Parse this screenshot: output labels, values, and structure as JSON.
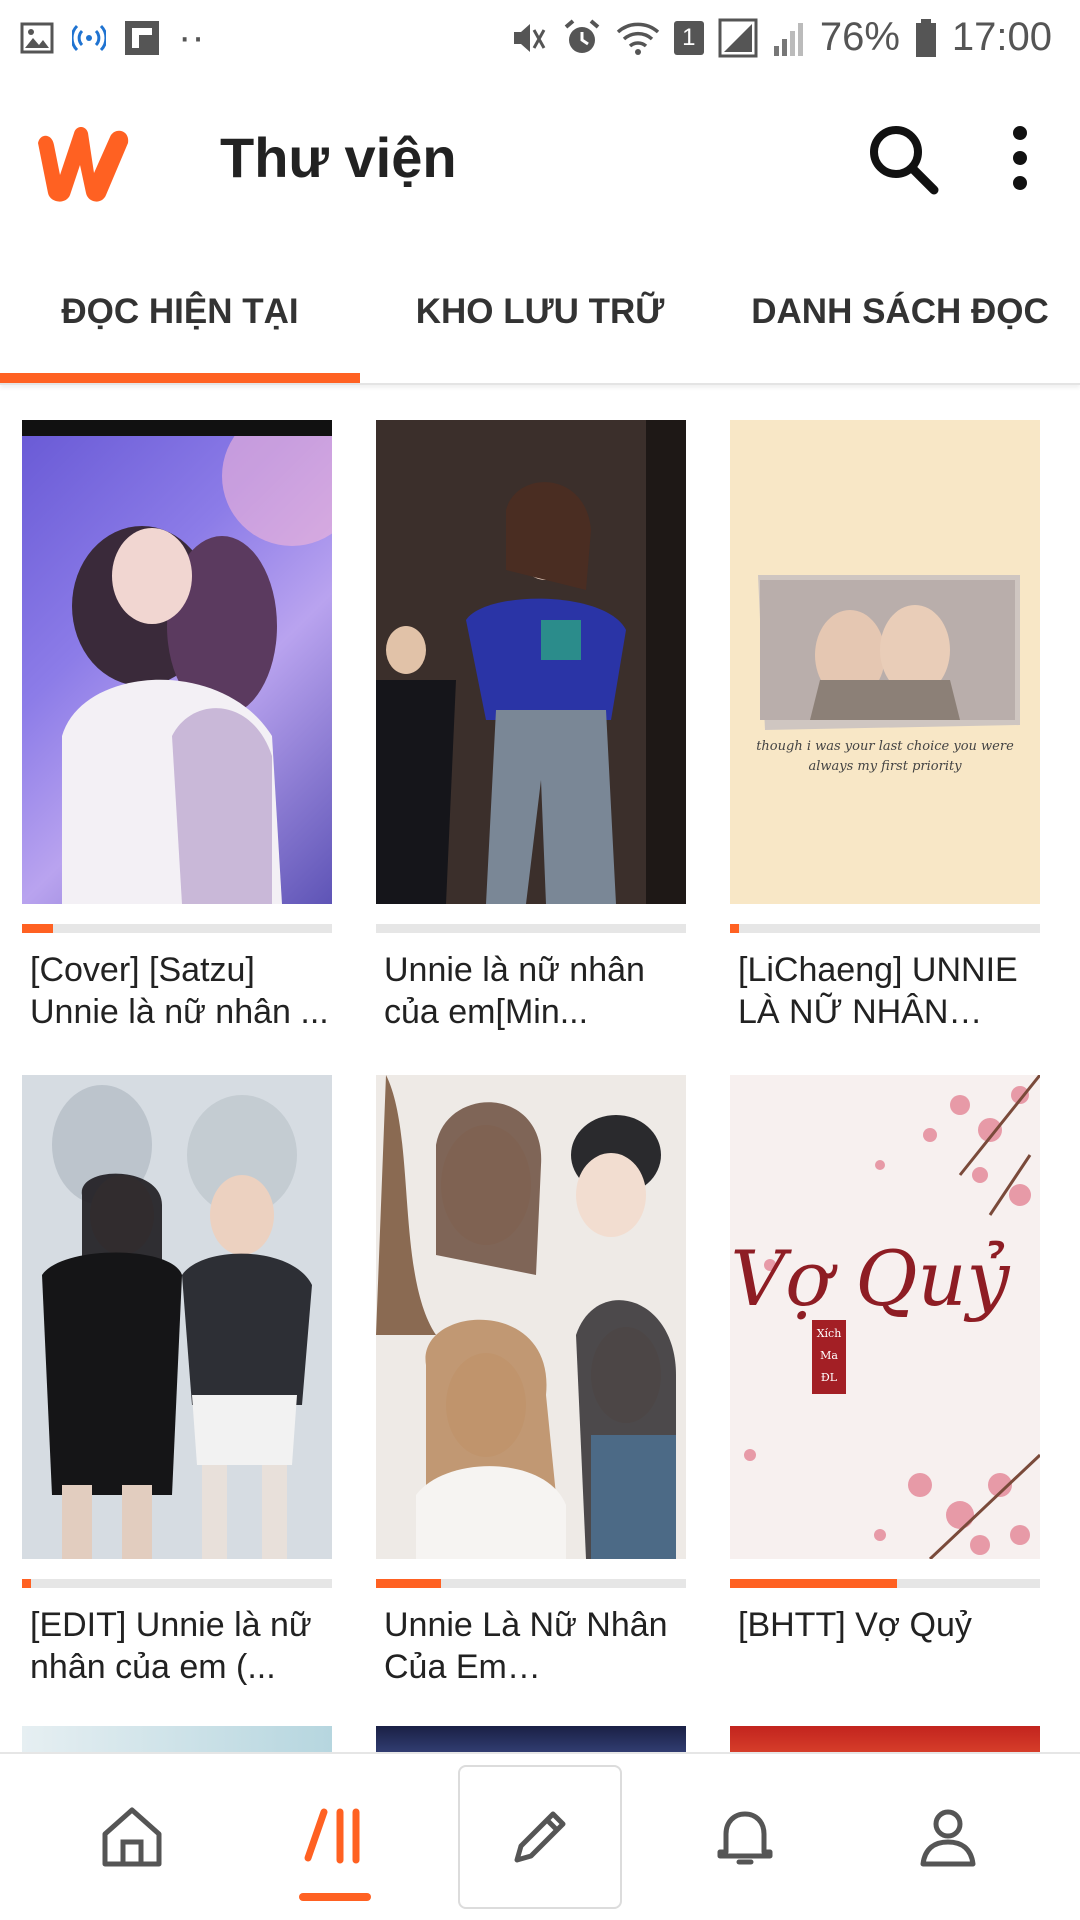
{
  "status_bar": {
    "battery": "76%",
    "time": "17:00",
    "sim_badge": "1"
  },
  "app_bar": {
    "title": "Thư viện",
    "logo_icon": "wattpad-w-logo",
    "search_icon": "search-icon",
    "more_icon": "more-vertical-icon",
    "brand_color": "#ff6122"
  },
  "tabs": [
    {
      "label": "ĐỌC HIỆN TẠI",
      "active": true
    },
    {
      "label": "KHO LƯU TRỮ",
      "active": false
    },
    {
      "label": "DANH SÁCH ĐỌC",
      "active": false
    }
  ],
  "stories": [
    {
      "title": "[Cover] [Satzu] Unnie là nữ nhân ...",
      "progress": 0.1
    },
    {
      "title": "Unnie là nữ nhân của em[Min...",
      "progress": 0.0
    },
    {
      "title": "[LiChaeng] UNNIE LÀ NỮ NHÂN CỦA...",
      "progress": 0.03
    },
    {
      "title": "[EDIT] Unnie là nữ nhân của em (...",
      "progress": 0.03
    },
    {
      "title": "Unnie Là Nữ Nhân Của Em (MINYEO...",
      "progress": 0.21
    },
    {
      "title": "[BHTT] Vợ Quỷ",
      "progress": 0.54
    }
  ],
  "cover_texts": {
    "story3": "though i was your last choice you were always my first priority",
    "story6_title": "Vợ Quỷ",
    "story6_author": "Xích Ma ĐL"
  },
  "bottom_nav": [
    {
      "name": "home",
      "icon": "home-icon",
      "active": false
    },
    {
      "name": "library",
      "icon": "library-icon",
      "active": true
    },
    {
      "name": "write",
      "icon": "pencil-icon",
      "active": false
    },
    {
      "name": "notifications",
      "icon": "bell-icon",
      "active": false
    },
    {
      "name": "profile",
      "icon": "person-icon",
      "active": false
    }
  ]
}
